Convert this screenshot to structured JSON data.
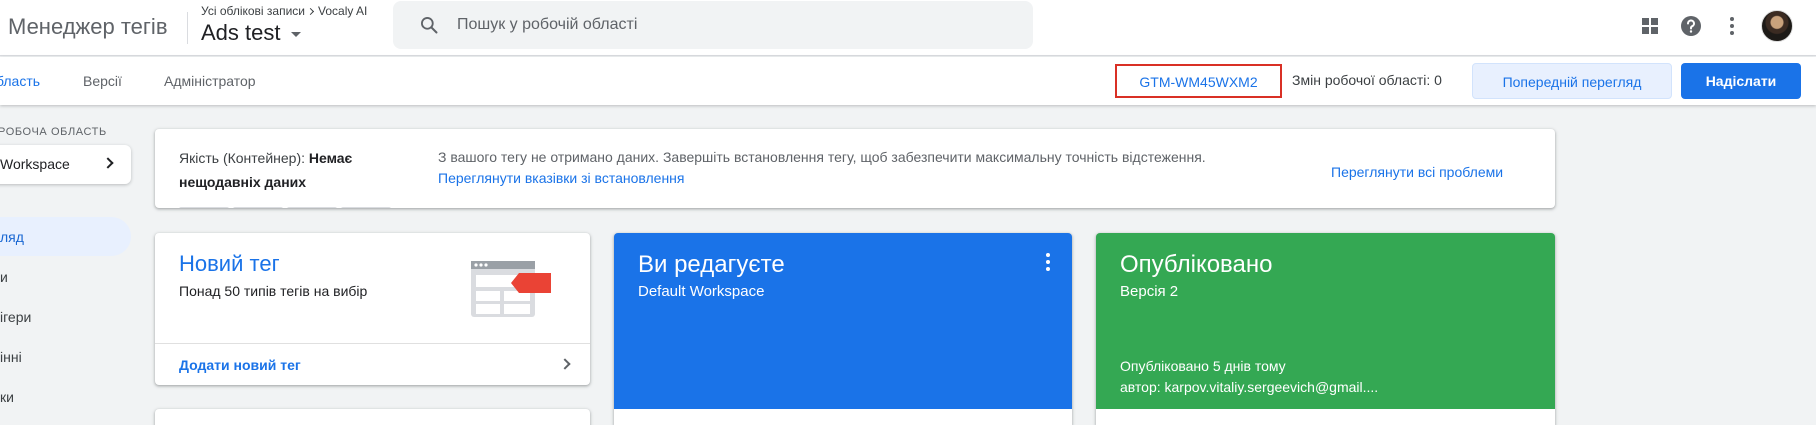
{
  "app": {
    "title": "Менеджер тегів"
  },
  "breadcrumb": {
    "all_accounts": "Усі облікові записи",
    "account": "Vocaly AI"
  },
  "container": {
    "name": "Ads test"
  },
  "search": {
    "placeholder": "Пошук у робочій області"
  },
  "icons": {
    "search": "search-icon",
    "apps": "apps-grid-icon",
    "help": "help-icon",
    "more": "more-vert-icon"
  },
  "nav": {
    "tabs": [
      {
        "label": "бласть"
      },
      {
        "label": "Версії"
      },
      {
        "label": "Адміністратор"
      }
    ],
    "container_id": "GTM-WM45WXM2",
    "workspace_changes": "Змін робочої області: 0",
    "preview_label": "Попередній перегляд",
    "submit_label": "Надіслати"
  },
  "sidebar": {
    "workspace_label": "РОБОЧА ОБЛАСТЬ",
    "workspace_name": "Workspace",
    "items": [
      {
        "label": "ляд"
      },
      {
        "label": "и"
      },
      {
        "label": "ігери"
      },
      {
        "label": "інні"
      },
      {
        "label": "ки"
      }
    ]
  },
  "quality": {
    "prefix": "Якість (Контейнер):",
    "status": "Немає нещодавніх даних",
    "message": "З вашого тегу не отримано даних. Завершіть встановлення тегу, щоб забезпечити максимальну точність відстеження.",
    "setup_link": "Переглянути вказівки зі встановлення",
    "all_issues_link": "Переглянути всі проблеми"
  },
  "new_tag": {
    "title": "Новий тег",
    "subtitle": "Понад 50 типів тегів на вибір",
    "add_label": "Додати новий тег"
  },
  "editing": {
    "title": "Ви редагуєте",
    "workspace": "Default Workspace"
  },
  "published": {
    "title": "Опубліковано",
    "version": "Версія 2",
    "published_ago": "Опубліковано 5 днів тому",
    "author": "автор: karpov.vitaliy.sergeevich@gmail...."
  },
  "colors": {
    "accent": "#1a73e8",
    "editing_bg": "#1a73e8",
    "published_bg": "#34a853",
    "highlight_border": "#d93025"
  }
}
